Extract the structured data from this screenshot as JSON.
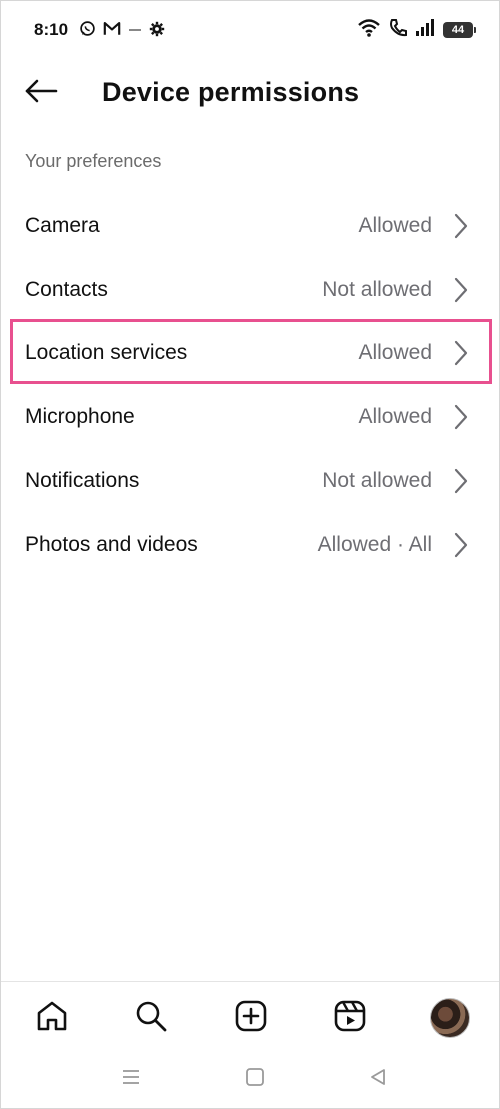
{
  "status_bar": {
    "time": "8:10",
    "battery": "44",
    "left_icons": [
      "whatsapp-icon",
      "gmail-icon",
      "minus-icon",
      "settings-icon"
    ],
    "right_icons": [
      "wifi-icon",
      "call-icon",
      "signal-icon",
      "battery-icon"
    ]
  },
  "header": {
    "title": "Device permissions",
    "back_icon": "arrow-left-icon"
  },
  "section": {
    "title": "Your preferences"
  },
  "permissions": [
    {
      "label": "Camera",
      "value": "Allowed"
    },
    {
      "label": "Contacts",
      "value": "Not allowed"
    },
    {
      "label": "Location services",
      "value": "Allowed",
      "highlighted": true
    },
    {
      "label": "Microphone",
      "value": "Allowed"
    },
    {
      "label": "Notifications",
      "value": "Not allowed"
    },
    {
      "label": "Photos and videos",
      "value": "Allowed · All"
    }
  ],
  "highlight_color": "#e8508f",
  "bottom_nav": [
    "home-icon",
    "search-icon",
    "create-icon",
    "reels-icon",
    "profile-avatar"
  ],
  "system_nav": [
    "menu-icon",
    "home-square-icon",
    "back-triangle-icon"
  ]
}
